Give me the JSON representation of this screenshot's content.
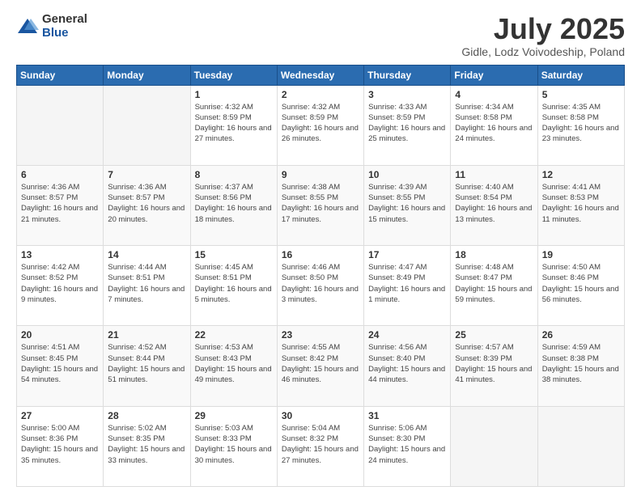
{
  "logo": {
    "general": "General",
    "blue": "Blue"
  },
  "header": {
    "month": "July 2025",
    "location": "Gidle, Lodz Voivodeship, Poland"
  },
  "weekdays": [
    "Sunday",
    "Monday",
    "Tuesday",
    "Wednesday",
    "Thursday",
    "Friday",
    "Saturday"
  ],
  "weeks": [
    [
      null,
      null,
      {
        "day": "1",
        "sunrise": "4:32 AM",
        "sunset": "8:59 PM",
        "daylight": "16 hours and 27 minutes."
      },
      {
        "day": "2",
        "sunrise": "4:32 AM",
        "sunset": "8:59 PM",
        "daylight": "16 hours and 26 minutes."
      },
      {
        "day": "3",
        "sunrise": "4:33 AM",
        "sunset": "8:59 PM",
        "daylight": "16 hours and 25 minutes."
      },
      {
        "day": "4",
        "sunrise": "4:34 AM",
        "sunset": "8:58 PM",
        "daylight": "16 hours and 24 minutes."
      },
      {
        "day": "5",
        "sunrise": "4:35 AM",
        "sunset": "8:58 PM",
        "daylight": "16 hours and 23 minutes."
      }
    ],
    [
      {
        "day": "6",
        "sunrise": "4:36 AM",
        "sunset": "8:57 PM",
        "daylight": "16 hours and 21 minutes."
      },
      {
        "day": "7",
        "sunrise": "4:36 AM",
        "sunset": "8:57 PM",
        "daylight": "16 hours and 20 minutes."
      },
      {
        "day": "8",
        "sunrise": "4:37 AM",
        "sunset": "8:56 PM",
        "daylight": "16 hours and 18 minutes."
      },
      {
        "day": "9",
        "sunrise": "4:38 AM",
        "sunset": "8:55 PM",
        "daylight": "16 hours and 17 minutes."
      },
      {
        "day": "10",
        "sunrise": "4:39 AM",
        "sunset": "8:55 PM",
        "daylight": "16 hours and 15 minutes."
      },
      {
        "day": "11",
        "sunrise": "4:40 AM",
        "sunset": "8:54 PM",
        "daylight": "16 hours and 13 minutes."
      },
      {
        "day": "12",
        "sunrise": "4:41 AM",
        "sunset": "8:53 PM",
        "daylight": "16 hours and 11 minutes."
      }
    ],
    [
      {
        "day": "13",
        "sunrise": "4:42 AM",
        "sunset": "8:52 PM",
        "daylight": "16 hours and 9 minutes."
      },
      {
        "day": "14",
        "sunrise": "4:44 AM",
        "sunset": "8:51 PM",
        "daylight": "16 hours and 7 minutes."
      },
      {
        "day": "15",
        "sunrise": "4:45 AM",
        "sunset": "8:51 PM",
        "daylight": "16 hours and 5 minutes."
      },
      {
        "day": "16",
        "sunrise": "4:46 AM",
        "sunset": "8:50 PM",
        "daylight": "16 hours and 3 minutes."
      },
      {
        "day": "17",
        "sunrise": "4:47 AM",
        "sunset": "8:49 PM",
        "daylight": "16 hours and 1 minute."
      },
      {
        "day": "18",
        "sunrise": "4:48 AM",
        "sunset": "8:47 PM",
        "daylight": "15 hours and 59 minutes."
      },
      {
        "day": "19",
        "sunrise": "4:50 AM",
        "sunset": "8:46 PM",
        "daylight": "15 hours and 56 minutes."
      }
    ],
    [
      {
        "day": "20",
        "sunrise": "4:51 AM",
        "sunset": "8:45 PM",
        "daylight": "15 hours and 54 minutes."
      },
      {
        "day": "21",
        "sunrise": "4:52 AM",
        "sunset": "8:44 PM",
        "daylight": "15 hours and 51 minutes."
      },
      {
        "day": "22",
        "sunrise": "4:53 AM",
        "sunset": "8:43 PM",
        "daylight": "15 hours and 49 minutes."
      },
      {
        "day": "23",
        "sunrise": "4:55 AM",
        "sunset": "8:42 PM",
        "daylight": "15 hours and 46 minutes."
      },
      {
        "day": "24",
        "sunrise": "4:56 AM",
        "sunset": "8:40 PM",
        "daylight": "15 hours and 44 minutes."
      },
      {
        "day": "25",
        "sunrise": "4:57 AM",
        "sunset": "8:39 PM",
        "daylight": "15 hours and 41 minutes."
      },
      {
        "day": "26",
        "sunrise": "4:59 AM",
        "sunset": "8:38 PM",
        "daylight": "15 hours and 38 minutes."
      }
    ],
    [
      {
        "day": "27",
        "sunrise": "5:00 AM",
        "sunset": "8:36 PM",
        "daylight": "15 hours and 35 minutes."
      },
      {
        "day": "28",
        "sunrise": "5:02 AM",
        "sunset": "8:35 PM",
        "daylight": "15 hours and 33 minutes."
      },
      {
        "day": "29",
        "sunrise": "5:03 AM",
        "sunset": "8:33 PM",
        "daylight": "15 hours and 30 minutes."
      },
      {
        "day": "30",
        "sunrise": "5:04 AM",
        "sunset": "8:32 PM",
        "daylight": "15 hours and 27 minutes."
      },
      {
        "day": "31",
        "sunrise": "5:06 AM",
        "sunset": "8:30 PM",
        "daylight": "15 hours and 24 minutes."
      },
      null,
      null
    ]
  ]
}
